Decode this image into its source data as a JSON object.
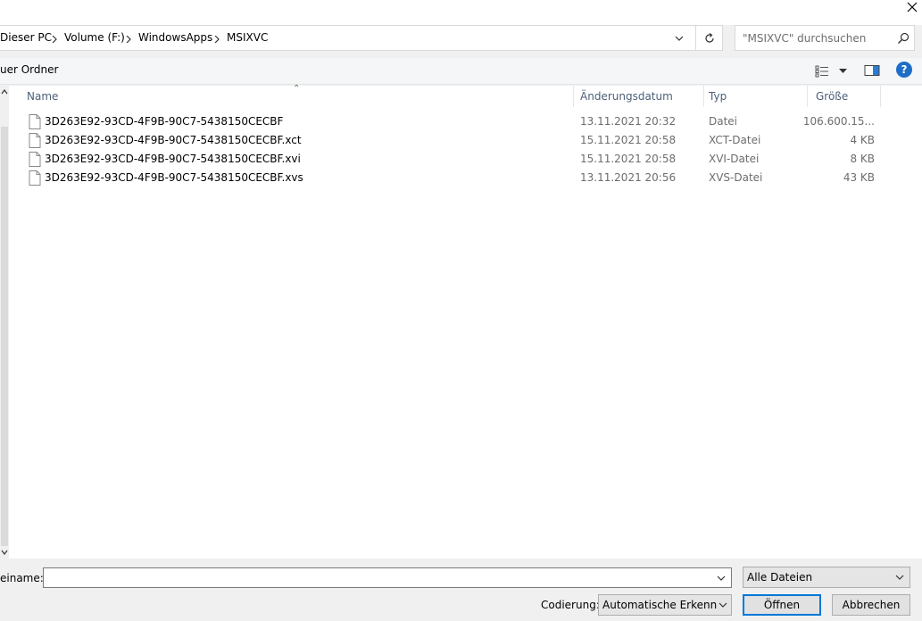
{
  "window": {
    "close_glyph": "✕"
  },
  "address": {
    "crumbs": [
      "Dieser PC",
      "Volume (F:)",
      "WindowsApps",
      "MSIXVC"
    ]
  },
  "search": {
    "placeholder": "\"MSIXVC\" durchsuchen"
  },
  "toolbar": {
    "new_folder_label": "uer Ordner",
    "help_label": "?"
  },
  "columns": {
    "name": "Name",
    "date": "Änderungsdatum",
    "type": "Typ",
    "size": "Größe"
  },
  "files": [
    {
      "name": "3D263E92-93CD-4F9B-90C7-5438150CECBF",
      "date": "13.11.2021 20:32",
      "type": "Datei",
      "size": "106.600.15..."
    },
    {
      "name": "3D263E92-93CD-4F9B-90C7-5438150CECBF.xct",
      "date": "15.11.2021 20:58",
      "type": "XCT-Datei",
      "size": "4 KB"
    },
    {
      "name": "3D263E92-93CD-4F9B-90C7-5438150CECBF.xvi",
      "date": "15.11.2021 20:58",
      "type": "XVI-Datei",
      "size": "8 KB"
    },
    {
      "name": "3D263E92-93CD-4F9B-90C7-5438150CECBF.xvs",
      "date": "13.11.2021 20:56",
      "type": "XVS-Datei",
      "size": "43 KB"
    }
  ],
  "bottom": {
    "filename_label": "einame:",
    "filename_value": "",
    "filetype_value": "Alle Dateien",
    "encoding_label": "Codierung:",
    "encoding_value": "Automatische Erkennung",
    "open_label": "Öffnen",
    "cancel_label": "Abbrechen"
  },
  "colors": {
    "accent": "#0078d7",
    "help": "#1e6ec8",
    "header_text": "#4c607a"
  }
}
